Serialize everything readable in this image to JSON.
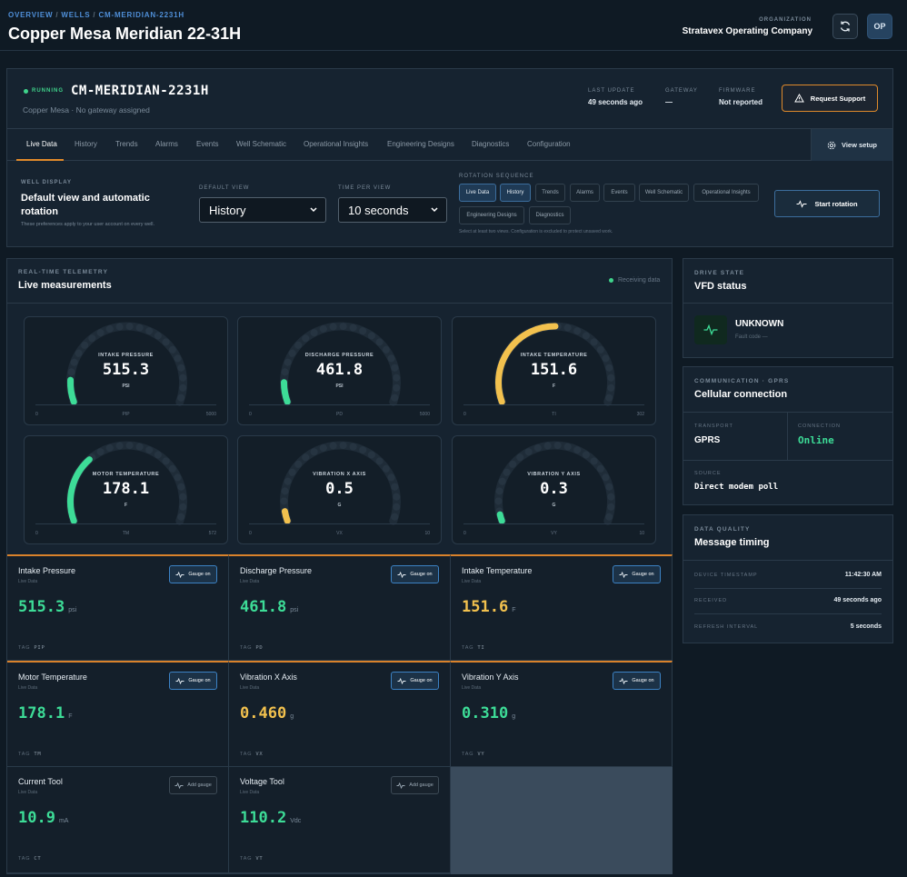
{
  "header": {
    "breadcrumb": [
      "OVERVIEW",
      "WELLS",
      "CM-MERIDIAN-2231H"
    ],
    "title": "Copper Mesa Meridian 22-31H",
    "org_label": "ORGANIZATION",
    "org_name": "Stratavex Operating Company",
    "avatar": "OP",
    "refresh_icon": "refresh-icon"
  },
  "well": {
    "status": "RUNNING",
    "id": "CM-MERIDIAN-2231H",
    "subtitle": "Copper Mesa · No gateway assigned",
    "meta": [
      {
        "label": "LAST UPDATE",
        "value": "49 seconds ago"
      },
      {
        "label": "GATEWAY",
        "value": "—"
      },
      {
        "label": "FIRMWARE",
        "value": "Not reported"
      }
    ],
    "request_support": "Request Support"
  },
  "tabs": [
    "Live Data",
    "History",
    "Trends",
    "Alarms",
    "Events",
    "Well Schematic",
    "Operational Insights",
    "Engineering Designs",
    "Diagnostics",
    "Configuration"
  ],
  "view_setup": "View setup",
  "display": {
    "label": "WELL DISPLAY",
    "title": "Default view and automatic rotation",
    "note": "These preferences apply to your user account on every well.",
    "default_view_label": "DEFAULT VIEW",
    "default_view": "History",
    "time_per_view_label": "TIME PER VIEW",
    "time_per_view": "10 seconds",
    "rotation_label": "ROTATION SEQUENCE",
    "rotation_chips": [
      "Live Data",
      "History",
      "Trends",
      "Alarms",
      "Events",
      "Well Schematic",
      "Operational Insights",
      "Engineering Designs",
      "Diagnostics"
    ],
    "rotation_note": "Select at least two views. Configuration is excluded to protect unsaved work.",
    "start_rotation": "Start rotation"
  },
  "telemetry": {
    "label": "REAL-TIME TELEMETRY",
    "title": "Live measurements",
    "status": "Receiving data",
    "gauges": [
      {
        "name": "INTAKE PRESSURE",
        "value": "515.3",
        "unit": "PSI",
        "min": "0",
        "tag": "PIP",
        "max": "5000",
        "fraction": 0.103,
        "color": "#3ddc97"
      },
      {
        "name": "DISCHARGE PRESSURE",
        "value": "461.8",
        "unit": "PSI",
        "min": "0",
        "tag": "PD",
        "max": "5000",
        "fraction": 0.092,
        "color": "#3ddc97"
      },
      {
        "name": "INTAKE TEMPERATURE",
        "value": "151.6",
        "unit": "F",
        "min": "0",
        "tag": "TI",
        "max": "302",
        "fraction": 0.502,
        "color": "#f2c14e"
      },
      {
        "name": "MOTOR TEMPERATURE",
        "value": "178.1",
        "unit": "F",
        "min": "0",
        "tag": "TM",
        "max": "572",
        "fraction": 0.311,
        "color": "#3ddc97"
      },
      {
        "name": "VIBRATION X AXIS",
        "value": "0.5",
        "unit": "G",
        "min": "0",
        "tag": "VX",
        "max": "10",
        "fraction": 0.046,
        "color": "#f2c14e"
      },
      {
        "name": "VIBRATION Y AXIS",
        "value": "0.3",
        "unit": "G",
        "min": "0",
        "tag": "VY",
        "max": "10",
        "fraction": 0.031,
        "color": "#3ddc97"
      }
    ],
    "tiles": [
      {
        "name": "Intake Pressure",
        "sub": "Live Data",
        "value": "515.3",
        "unit": "psi",
        "tag": "PIP",
        "button": "Gauge on",
        "color": "#3ddc97"
      },
      {
        "name": "Discharge Pressure",
        "sub": "Live Data",
        "value": "461.8",
        "unit": "psi",
        "tag": "PD",
        "button": "Gauge on",
        "color": "#3ddc97"
      },
      {
        "name": "Intake Temperature",
        "sub": "Live Data",
        "value": "151.6",
        "unit": "F",
        "tag": "TI",
        "button": "Gauge on",
        "color": "#f2c14e"
      },
      {
        "name": "Motor Temperature",
        "sub": "Live Data",
        "value": "178.1",
        "unit": "F",
        "tag": "TM",
        "button": "Gauge on",
        "color": "#3ddc97"
      },
      {
        "name": "Vibration X Axis",
        "sub": "Live Data",
        "value": "0.460",
        "unit": "g",
        "tag": "VX",
        "button": "Gauge on",
        "color": "#f2c14e"
      },
      {
        "name": "Vibration Y Axis",
        "sub": "Live Data",
        "value": "0.310",
        "unit": "g",
        "tag": "VY",
        "button": "Gauge on",
        "color": "#3ddc97"
      },
      {
        "name": "Current Tool",
        "sub": "Live Data",
        "value": "10.9",
        "unit": "mA",
        "tag": "CT",
        "button": "Add gauge",
        "color": "#3ddc97"
      },
      {
        "name": "Voltage Tool",
        "sub": "Live Data",
        "value": "110.2",
        "unit": "Vdc",
        "tag": "VT",
        "button": "Add gauge",
        "color": "#3ddc97"
      }
    ],
    "tag_label": "TAG"
  },
  "drive": {
    "label": "DRIVE STATE",
    "title": "VFD status",
    "state": "UNKNOWN",
    "fault": "Fault code —"
  },
  "comm": {
    "label": "COMMUNICATION · GPRS",
    "title": "Cellular connection",
    "transport_label": "TRANSPORT",
    "transport": "GPRS",
    "connection_label": "CONNECTION",
    "connection": "Online",
    "source_label": "SOURCE",
    "source": "Direct modem poll"
  },
  "quality": {
    "label": "DATA QUALITY",
    "title": "Message timing",
    "rows": [
      {
        "label": "DEVICE TIMESTAMP",
        "value": "11:42:30 AM"
      },
      {
        "label": "RECEIVED",
        "value": "49 seconds ago"
      },
      {
        "label": "REFRESH INTERVAL",
        "value": "5 seconds"
      }
    ]
  }
}
